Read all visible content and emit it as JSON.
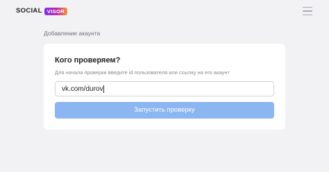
{
  "header": {
    "logo_text": "SOCIAL",
    "logo_badge": "VISOR",
    "menu_icon": "hamburger-menu-icon"
  },
  "section_title": "Добавление акаунта",
  "form": {
    "title": "Кого проверяем?",
    "hint": "Для начала проверки введите id пользователя или ссылку на его акаунт",
    "input_value": "vk.com/durov",
    "submit_label": "Запустить проверку"
  },
  "colors": {
    "background": "#f2f2f4",
    "card": "#ffffff",
    "button": "#8cb6f1",
    "badge_gradient": [
      "#7b2ff7",
      "#c02aa8",
      "#f29a2e"
    ]
  }
}
